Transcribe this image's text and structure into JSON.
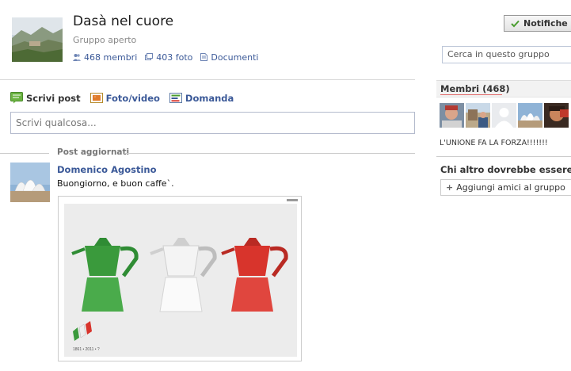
{
  "group": {
    "title": "Dasà nel cuore",
    "type": "Gruppo aperto",
    "stats": [
      {
        "icon": "members-icon",
        "label": "468 membri"
      },
      {
        "icon": "photos-icon",
        "label": "403 foto"
      },
      {
        "icon": "documents-icon",
        "label": "Documenti"
      }
    ]
  },
  "header": {
    "notifications_label": "Notifiche",
    "search_placeholder": "Cerca in questo gruppo"
  },
  "composer": {
    "tabs": [
      {
        "icon": "write-post-icon",
        "label": "Scrivi post"
      },
      {
        "icon": "photo-video-icon",
        "label": "Foto/video"
      },
      {
        "icon": "question-icon",
        "label": "Domanda"
      }
    ],
    "placeholder": "Scrivi qualcosa..."
  },
  "feed": {
    "section_label": "Post aggiornati",
    "post": {
      "author": "Domenico Agostino",
      "text": "Buongiorno, e buon caffe`.",
      "photo_caption": "1861 • 2011 • ?"
    }
  },
  "sidebar": {
    "members_title": "Membri (468)",
    "member_motto": "L'UNIONE FA LA FORZA!!!!!!!",
    "suggest_title": "Chi altro dovrebbe essere nel",
    "add_friends_label": "Aggiungi amici al gruppo"
  },
  "colors": {
    "link": "#3b5998",
    "notif_check": "#4a9d2f",
    "italy_green": "#3a9a3c",
    "italy_red": "#d8342c"
  }
}
